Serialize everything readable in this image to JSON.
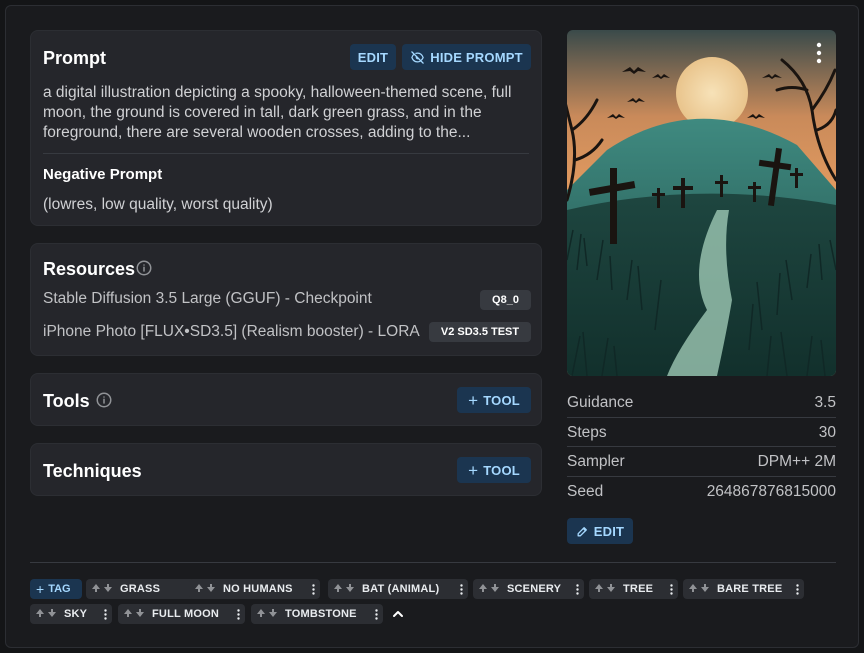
{
  "prompt": {
    "title": "Prompt",
    "edit_label": "EDIT",
    "hide_label": "HIDE PROMPT",
    "text": "a digital illustration depicting a spooky, halloween-themed scene, full moon, the ground is covered in tall, dark green grass, and in the foreground, there are several wooden crosses, adding to the...",
    "negative_title": "Negative Prompt",
    "negative_text": "(lowres, low quality, worst quality)"
  },
  "resources": {
    "title": "Resources",
    "items": [
      {
        "name": "Stable Diffusion 3.5 Large (GGUF) - Checkpoint",
        "badge": "Q8_0"
      },
      {
        "name": "iPhone Photo [FLUX•SD3.5] (Realism booster) - LORA",
        "badge": "V2 SD3.5 TEST"
      }
    ]
  },
  "tools": {
    "title": "Tools",
    "add_label": "TOOL"
  },
  "techniques": {
    "title": "Techniques",
    "add_label": "TOOL"
  },
  "params": [
    {
      "label": "Guidance",
      "value": "3.5"
    },
    {
      "label": "Steps",
      "value": "30"
    },
    {
      "label": "Sampler",
      "value": "DPM++ 2M"
    },
    {
      "label": "Seed",
      "value": "264867876815000"
    }
  ],
  "params_edit_label": "EDIT",
  "tags": {
    "add_label": "TAG",
    "items": [
      "GRASS",
      "NO HUMANS",
      "BAT (ANIMAL)",
      "SCENERY",
      "TREE",
      "BARE TREE",
      "SKY",
      "FULL MOON",
      "TOMBSTONE"
    ]
  },
  "colors": {
    "accent": "#a5d8ff",
    "accent_bg": "#1b3550",
    "card_bg": "#25262b",
    "page_bg": "#1a1b1e"
  }
}
